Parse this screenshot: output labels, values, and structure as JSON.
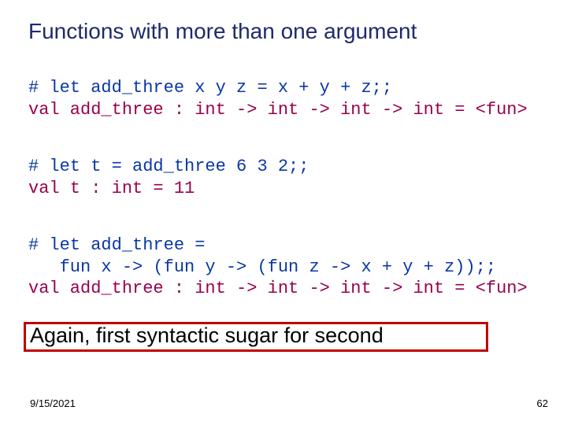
{
  "title": "Functions with more than one argument",
  "code": {
    "block1": {
      "prompt": "# let add_three x y z = x + y + z;;",
      "response": "val add_three : int -> int -> int -> int = <fun>"
    },
    "block2": {
      "prompt": "# let t = add_three 6 3 2;;",
      "response": "val t : int = 11"
    },
    "block3": {
      "prompt_line1": "# let add_three =",
      "prompt_line2": "   fun x -> (fun y -> (fun z -> x + y + z));;",
      "response": "val add_three : int -> int -> int -> int = <fun>"
    }
  },
  "callout": "Again, first syntactic sugar for second",
  "footer": {
    "date": "9/15/2021",
    "page": "62"
  }
}
